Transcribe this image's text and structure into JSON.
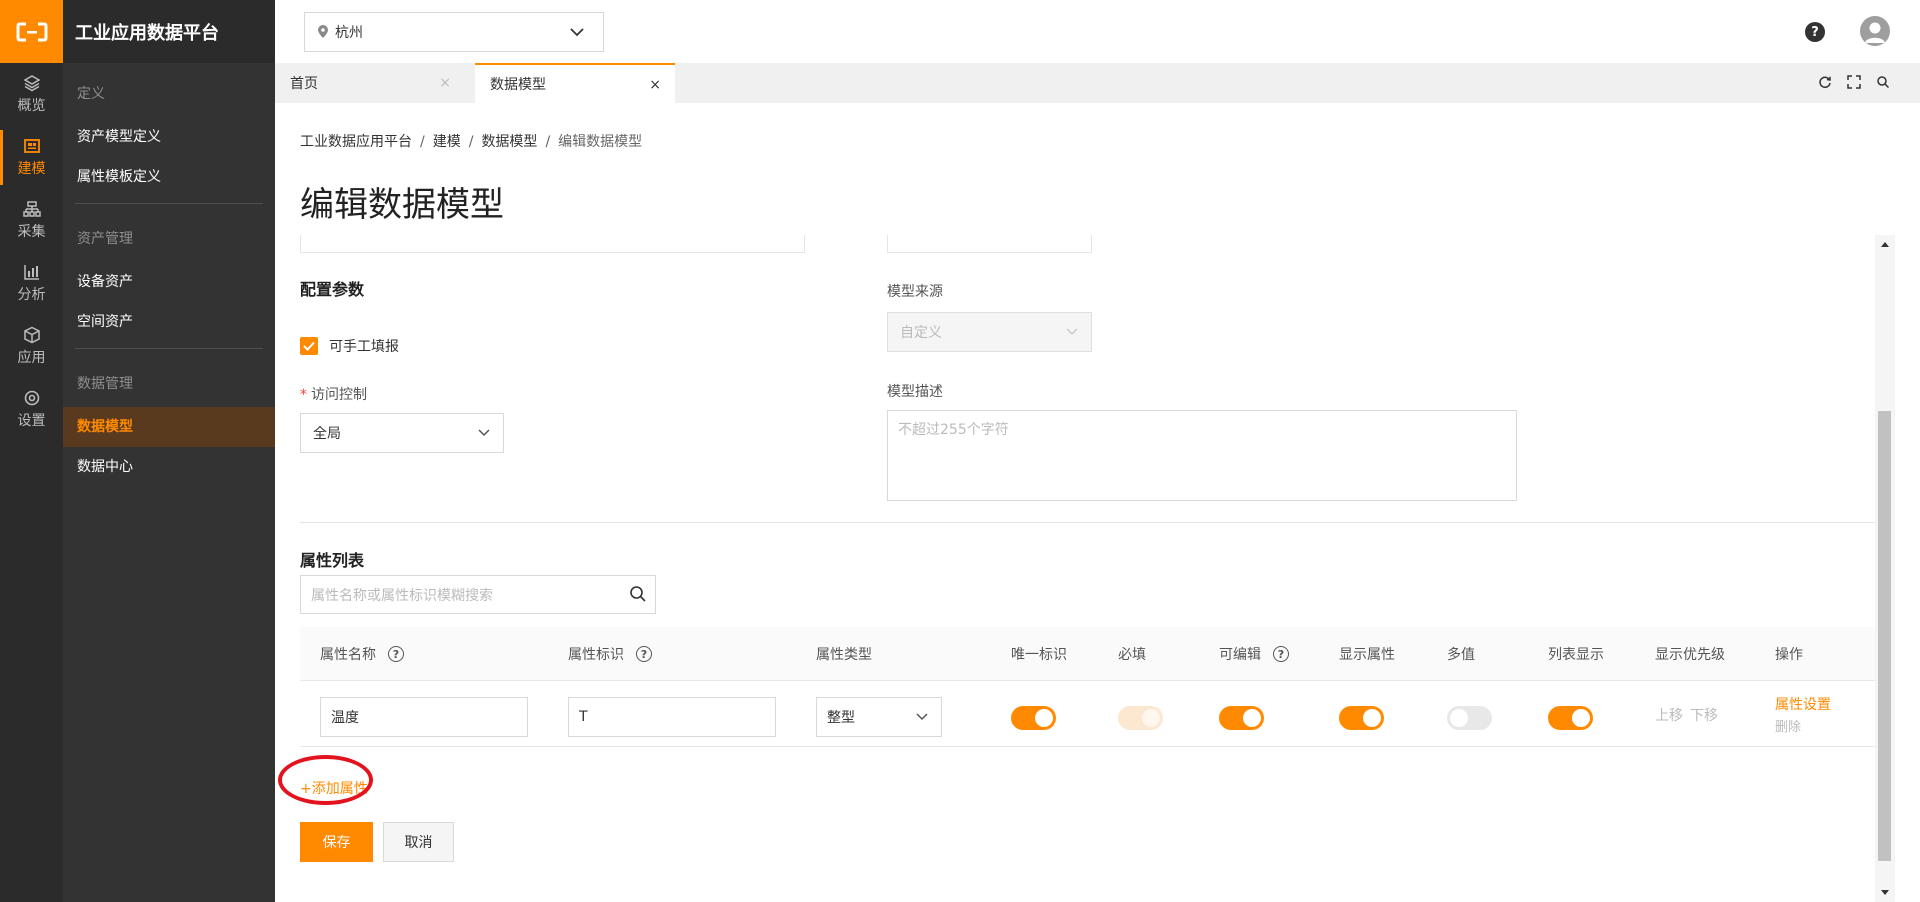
{
  "app": {
    "brand": "工业应用数据平台"
  },
  "rail": {
    "items": [
      {
        "label": "概览",
        "icon": "layers-icon"
      },
      {
        "label": "建模",
        "icon": "model-icon",
        "active": true
      },
      {
        "label": "采集",
        "icon": "sitemap-icon"
      },
      {
        "label": "分析",
        "icon": "chart-icon"
      },
      {
        "label": "应用",
        "icon": "cube-icon"
      },
      {
        "label": "设置",
        "icon": "settings-icon"
      }
    ]
  },
  "subnav": {
    "group1": {
      "title": "定义",
      "items": [
        "资产模型定义",
        "属性模板定义"
      ]
    },
    "group2": {
      "title": "资产管理",
      "items": [
        "设备资产",
        "空间资产"
      ]
    },
    "group3": {
      "title": "数据管理",
      "items": [
        "数据模型",
        "数据中心"
      ],
      "active_item": "数据模型"
    }
  },
  "topbar": {
    "city": "杭州",
    "help": "?"
  },
  "tabs": [
    {
      "label": "首页",
      "close": "×"
    },
    {
      "label": "数据模型",
      "close": "×",
      "active": true
    }
  ],
  "breadcrumb": [
    "工业数据应用平台",
    "建模",
    "数据模型",
    "编辑数据模型"
  ],
  "breadcrumb_sep": "/",
  "page_title": "编辑数据模型",
  "form": {
    "config_section": "配置参数",
    "manual_fill_label": "可手工填报",
    "manual_fill_checked": true,
    "access_label": "访问控制",
    "access_value": "全局",
    "source_label": "模型来源",
    "source_value": "自定义",
    "desc_label": "模型描述",
    "desc_placeholder": "不超过255个字符"
  },
  "attributes": {
    "section_title": "属性列表",
    "search_placeholder": "属性名称或属性标识模糊搜索",
    "columns": [
      "属性名称",
      "属性标识",
      "属性类型",
      "唯一标识",
      "必填",
      "可编辑",
      "显示属性",
      "多值",
      "列表显示",
      "显示优先级",
      "操作"
    ],
    "rows": [
      {
        "name": "温度",
        "identifier": "T",
        "type": "整型",
        "unique": true,
        "required": true,
        "editable": true,
        "display_attr": true,
        "multi_value": false,
        "list_display": true,
        "priority_up": "上移",
        "priority_down": "下移",
        "action_settings": "属性设置",
        "action_delete": "删除"
      }
    ],
    "add_label": "+添加属性"
  },
  "buttons": {
    "save": "保存",
    "cancel": "取消"
  },
  "colors": {
    "accent": "#ff8a00",
    "rail_bg": "#2b2b2b",
    "subnav_bg": "#333333",
    "annotation": "#e3131e"
  }
}
